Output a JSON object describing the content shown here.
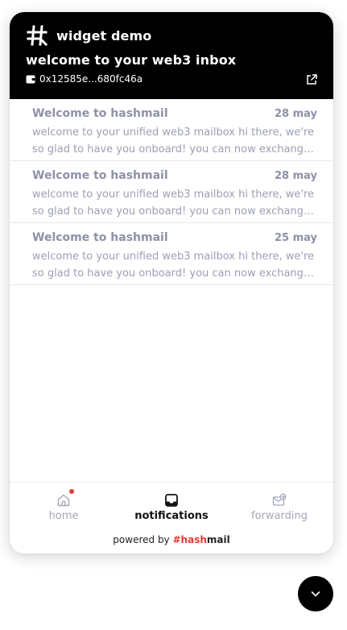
{
  "header": {
    "app_title": "widget demo",
    "welcome": "welcome to your web3 inbox",
    "address": "0x12585e...680fc46a",
    "logo_icon": "hash-logo-icon",
    "wallet_icon": "wallet-icon",
    "external_icon": "external-link-icon"
  },
  "messages": [
    {
      "title": "Welcome to hashmail",
      "date": "28 may",
      "line1": "welcome to your unified web3 mailbox   hi there, we're",
      "line2": "so glad to have you onboard! you can now exchange messages"
    },
    {
      "title": "Welcome to hashmail",
      "date": "28 may",
      "line1": "welcome to your unified web3 mailbox   hi there, we're",
      "line2": "so glad to have you onboard! you can now exchange messages"
    },
    {
      "title": "Welcome to hashmail",
      "date": "25 may",
      "line1": "welcome to your unified web3 mailbox   hi there, we're",
      "line2": "so glad to have you onboard! you can now exchange messages"
    }
  ],
  "nav": {
    "home": "home",
    "notifications": "notifications",
    "forwarding": "forwarding",
    "active": "notifications",
    "home_has_badge": true
  },
  "footer": {
    "powered_by": "powered by",
    "brand_hash": "#",
    "brand_hash_word": "hash",
    "brand_mail_word": "mail"
  },
  "colors": {
    "header_bg": "#000000",
    "accent": "#e53935",
    "muted_text": "#8e91a7"
  }
}
